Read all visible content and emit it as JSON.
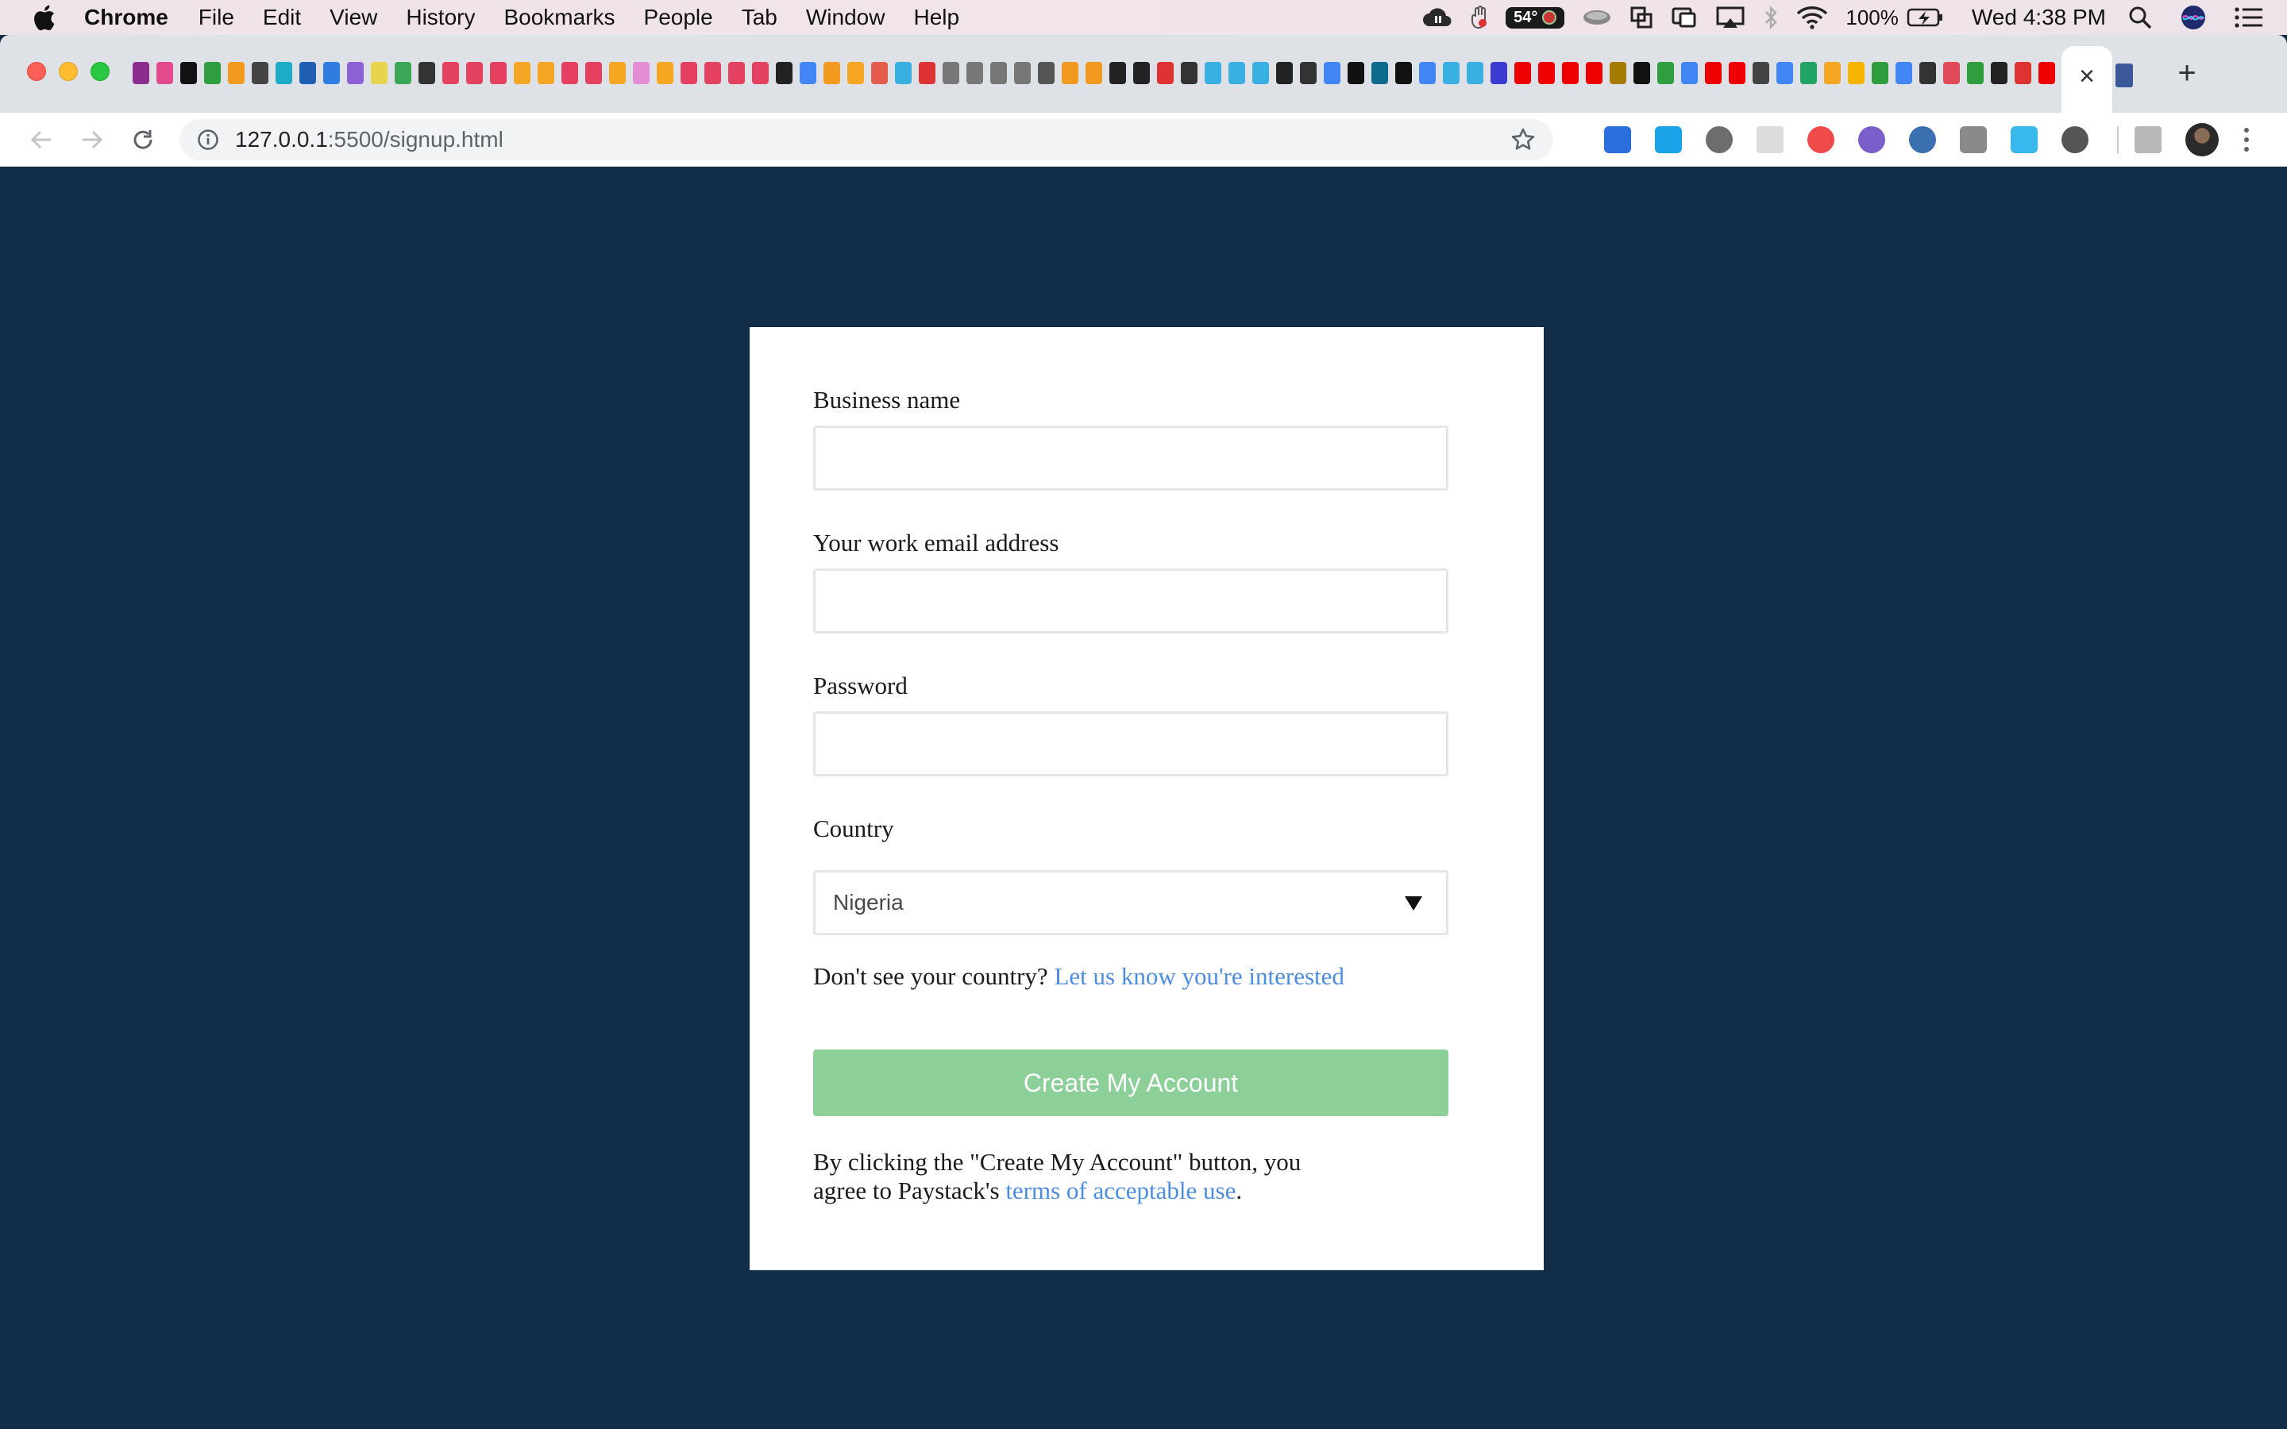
{
  "menubar": {
    "app": "Chrome",
    "items": [
      "File",
      "Edit",
      "View",
      "History",
      "Bookmarks",
      "People",
      "Tab",
      "Window",
      "Help"
    ],
    "temperature": "54°",
    "battery": "100%",
    "clock": "Wed 4:38 PM"
  },
  "browser": {
    "url_host": "127.0.0.1",
    "url_rest": ":5500/signup.html",
    "tab_close": "×",
    "new_tab": "+"
  },
  "form": {
    "business_name_label": "Business name",
    "business_name_value": "",
    "email_label": "Your work email address",
    "email_value": "",
    "password_label": "Password",
    "password_value": "",
    "country_label": "Country",
    "country_value": "Nigeria",
    "missing_country_text": "Don't see your country? ",
    "missing_country_link": "Let us know you're interested",
    "submit_label": "Create My Account",
    "terms_prefix": "By clicking the \"Create My Account\" button, you agree to Paystack's ",
    "terms_link": "terms of acceptable use",
    "terms_suffix": "."
  },
  "colors": {
    "page_background": "#122d47",
    "card_background": "#ffffff",
    "button": "#8ccf99",
    "link": "#4d8ddf"
  }
}
